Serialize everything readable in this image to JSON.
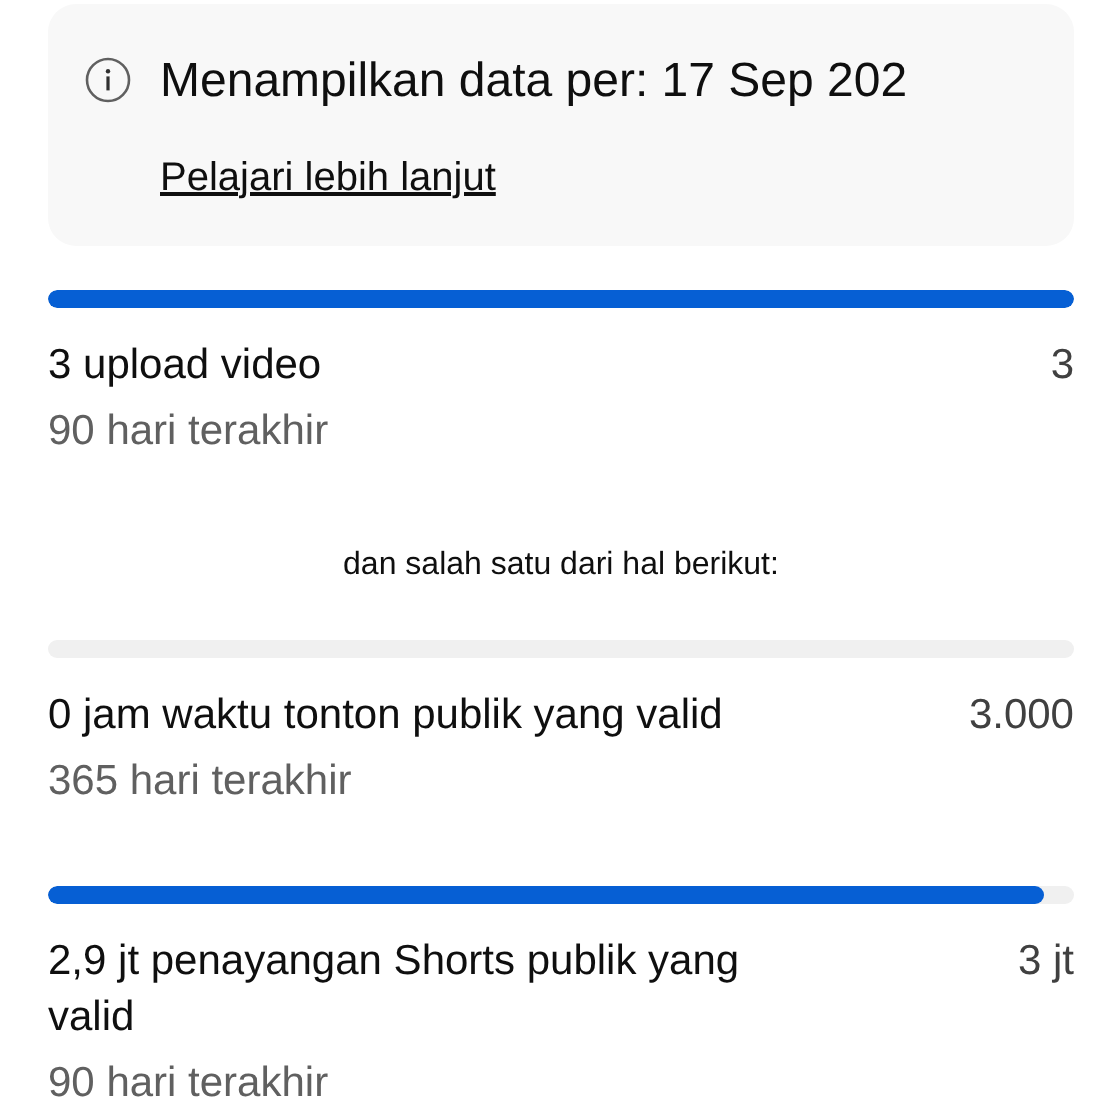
{
  "notice": {
    "title": "Menampilkan data per: 17 Sep 202",
    "link": "Pelajari lebih lanjut"
  },
  "requirements": [
    {
      "level": 1,
      "label": "3 upload video",
      "target": "3",
      "period": "90 hari terakhir"
    }
  ],
  "separator": "dan salah satu dari hal berikut:",
  "alternatives": [
    {
      "level": 0,
      "label": "0 jam waktu tonton publik yang valid",
      "target": "3.000",
      "period": "365 hari terakhir"
    },
    {
      "level": 0.97,
      "label": "2,9 jt penayangan Shorts publik yang valid",
      "target": "3 jt",
      "period": "90 hari terakhir"
    }
  ]
}
